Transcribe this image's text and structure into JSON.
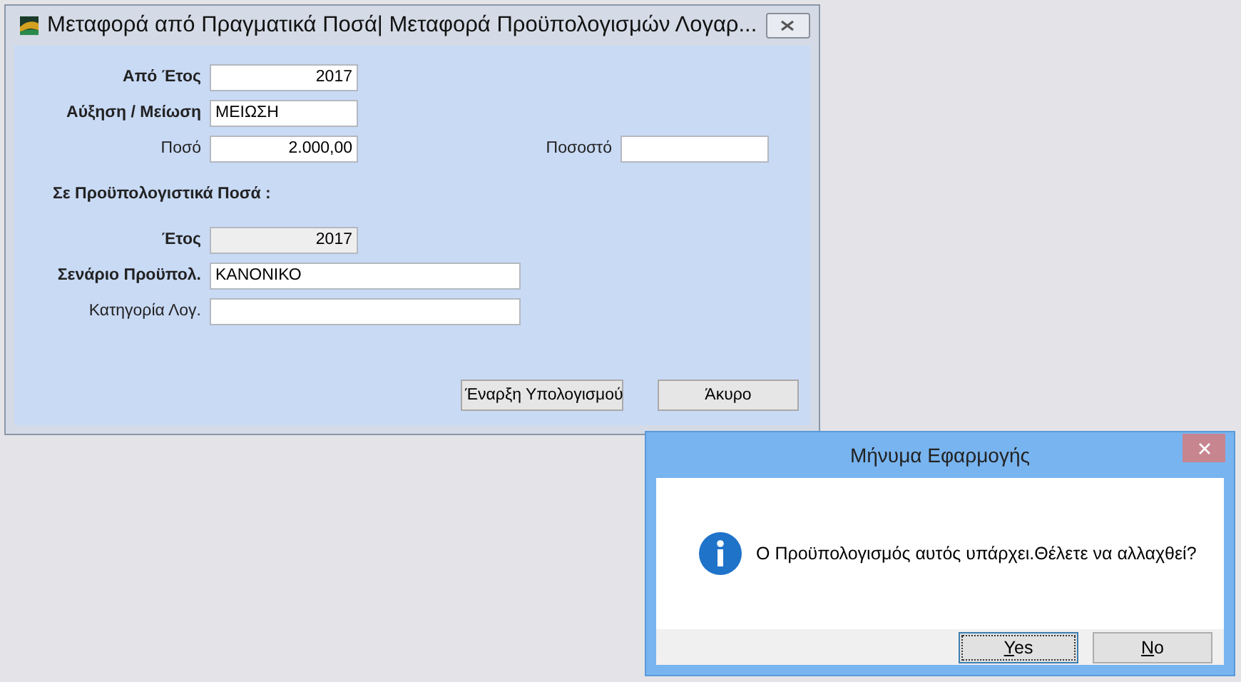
{
  "main_window": {
    "title": "Μεταφορά από Πραγματικά Ποσά| Μεταφορά Προϋπολογισμών Λογαρ...",
    "rows": [
      {
        "kind": "fields",
        "fields": [
          {
            "label": "Από Έτος",
            "bold": true,
            "value": "2017",
            "kind": "numeric",
            "disabled": false
          }
        ]
      },
      {
        "kind": "fields",
        "fields": [
          {
            "label": "Αύξηση / Μείωση",
            "bold": true,
            "value": "ΜΕΙΩΣΗ",
            "kind": "text",
            "disabled": false
          }
        ]
      },
      {
        "kind": "fields",
        "fields": [
          {
            "label": "Ποσό",
            "bold": false,
            "value": "2.000,00",
            "kind": "numeric",
            "disabled": false
          },
          {
            "label": "Ποσοστό",
            "bold": false,
            "kind": "text",
            "disabled": false
          }
        ]
      },
      {
        "kind": "heading",
        "text": "Σε Προϋπολογιστικά Ποσά :"
      },
      {
        "kind": "fields",
        "fields": [
          {
            "label": "Έτος",
            "bold": true,
            "value": "2017",
            "kind": "numeric",
            "disabled": true
          }
        ]
      },
      {
        "kind": "fields",
        "fields": [
          {
            "label": "Σενάριο Προϋπολ.",
            "bold": true,
            "value": "ΚΑΝΟΝΙΚΟ",
            "kind": "wide_text",
            "disabled": false
          }
        ]
      },
      {
        "kind": "fields",
        "fields": [
          {
            "label": "Κατηγορία Λογ.",
            "bold": false,
            "kind": "wide_text",
            "disabled": false
          }
        ]
      }
    ],
    "buttons": [
      {
        "label": "Έναρξη Υπολογισμού"
      },
      {
        "label": "Άκυρο"
      }
    ]
  },
  "message_dialog": {
    "title": "Μήνυμα Εφαρμογής",
    "message": "Ο Προϋπολογισμός αυτός υπάρχει.Θέλετε να αλλαχθεί?",
    "buttons": [
      {
        "label": "Yes",
        "focused": true
      },
      {
        "label": "No",
        "focused": false
      }
    ]
  }
}
